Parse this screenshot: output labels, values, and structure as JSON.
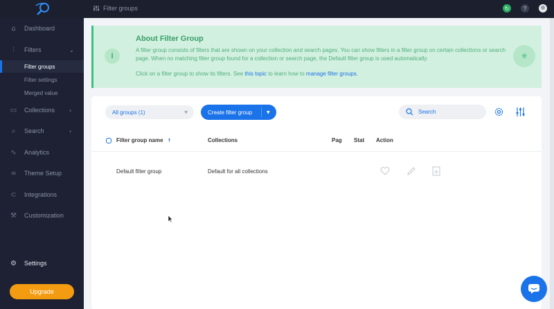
{
  "topbar": {
    "title": "Filter groups",
    "help": "?"
  },
  "sidebar": {
    "items": [
      {
        "label": "Dashboard",
        "icon": "home-icon"
      },
      {
        "label": "Filters",
        "icon": "filters-icon",
        "expanded": true
      },
      {
        "label": "Collections",
        "icon": "collections-icon"
      },
      {
        "label": "Search",
        "icon": "search-icon"
      },
      {
        "label": "Analytics",
        "icon": "analytics-icon"
      },
      {
        "label": "Theme Setup",
        "icon": "link-icon"
      },
      {
        "label": "Integrations",
        "icon": "integrations-icon"
      },
      {
        "label": "Customization",
        "icon": "wrench-icon"
      }
    ],
    "sub_items": [
      {
        "label": "Filter groups",
        "active": true
      },
      {
        "label": "Filter settings",
        "active": false
      },
      {
        "label": "Merged value",
        "active": false
      }
    ],
    "settings_label": "Settings",
    "upgrade_label": "Upgrade"
  },
  "info": {
    "title": "About Filter Group",
    "text": "A filter group consists of filters that are shown on your collection and search pages. You can show filters in a filter group on certain collections or search page. When no matching filter group found for a collection or search page, the Default filter group is used automatically.",
    "line2_prefix": "Click on a filter group to show its filters. See ",
    "line2_link1": "this topic",
    "line2_mid": " to learn how to ",
    "line2_link2": "manage filter groups",
    "line2_suffix": "."
  },
  "toolbar": {
    "groups_select": "All groups (1)",
    "create_label": "Create filter group",
    "search_placeholder": "Search"
  },
  "table": {
    "columns": [
      "Filter group name",
      "Collections",
      "Pag",
      "Stat",
      "Action"
    ],
    "rows": [
      {
        "name": "Default filter group",
        "collections": "Default for all collections"
      }
    ]
  },
  "colors": {
    "accent": "#1a73e8",
    "sidebar": "#1d2133",
    "upgrade": "#f39c12",
    "info_bg": "#d2f0df"
  }
}
